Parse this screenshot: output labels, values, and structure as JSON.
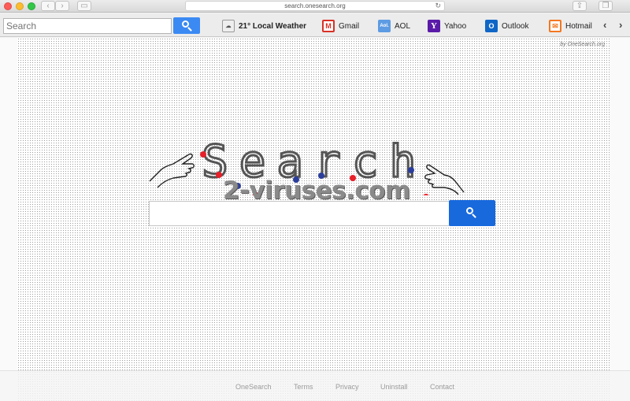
{
  "browser": {
    "url": "search.onesearch.org"
  },
  "toolbar": {
    "search_placeholder": "Search",
    "bookmarks": [
      {
        "label": "21° Local Weather",
        "icon": "weather-icon"
      },
      {
        "label": "Gmail",
        "icon": "gmail-icon"
      },
      {
        "label": "AOL",
        "icon": "aol-icon"
      },
      {
        "label": "Yahoo",
        "icon": "yahoo-icon"
      },
      {
        "label": "Outlook",
        "icon": "outlook-icon"
      },
      {
        "label": "Hotmail",
        "icon": "hotmail-icon"
      }
    ]
  },
  "page": {
    "attribution": "by OneSearch.org",
    "logo_text": "Search",
    "watermark": "2-viruses.com"
  },
  "footer": {
    "links": [
      "OneSearch",
      "Terms",
      "Privacy",
      "Uninstall",
      "Contact"
    ]
  },
  "colors": {
    "search_button": "#1769dc",
    "toolbar_search_button": "#3b8af3",
    "logo_dot_red": "#e8202a",
    "logo_dot_blue": "#2c3e9c"
  }
}
